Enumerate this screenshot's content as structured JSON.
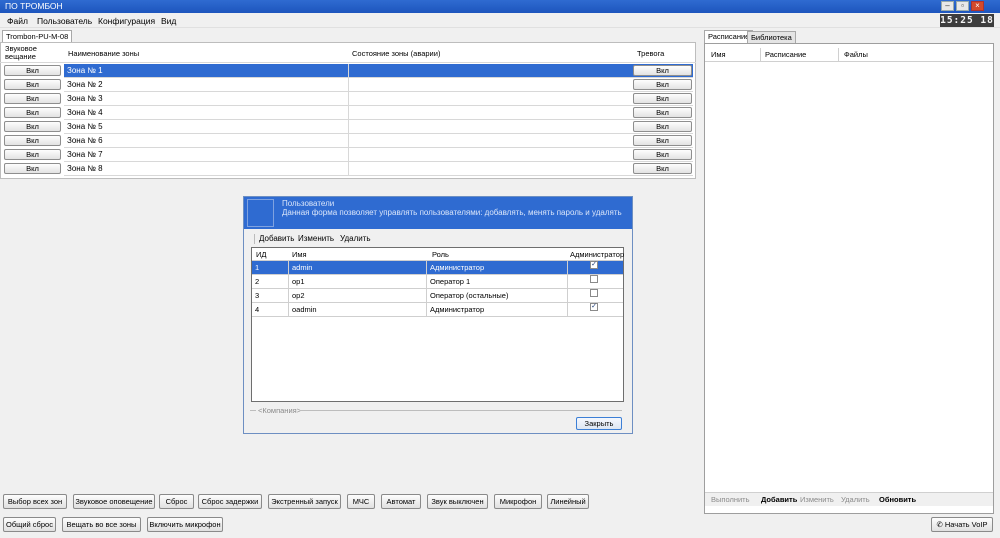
{
  "window": {
    "title": "ПО ТРОМБОН",
    "minimize": "–",
    "maximize": "▫",
    "close": "×"
  },
  "menu": [
    "Файл",
    "Пользователь",
    "Конфигурация",
    "Вид"
  ],
  "clock": "15:25 18",
  "device_tab": "Trombon-PU-M-08",
  "zones": {
    "headers": {
      "broadcast": "Звуковое вещание",
      "name": "Наименование зоны",
      "state": "Состояние зоны (аварии)",
      "alarm": "Тревога"
    },
    "button_label": "Вкл",
    "rows": [
      {
        "name": "Зона № 1"
      },
      {
        "name": "Зона № 2"
      },
      {
        "name": "Зона № 3"
      },
      {
        "name": "Зона № 4"
      },
      {
        "name": "Зона № 5"
      },
      {
        "name": "Зона № 6"
      },
      {
        "name": "Зона № 7"
      },
      {
        "name": "Зона № 8"
      }
    ],
    "selected_index": 0
  },
  "right_panel": {
    "tabs": [
      "Расписание",
      "Библиотека"
    ],
    "columns": [
      "Имя",
      "Расписание",
      "Файлы"
    ],
    "toolbar": {
      "run": "Выполнить",
      "add": "Добавить",
      "edit": "Изменить",
      "delete": "Удалить",
      "refresh": "Обновить"
    }
  },
  "bottom": {
    "row1": [
      "Выбор всех зон",
      "Звуковое оповещение",
      "Сброс",
      "Сброс задержки",
      "Экстренный запуск",
      "МЧС",
      "Автомат",
      "Звук выключен",
      "Микрофон",
      "Линейный"
    ],
    "row2": [
      "Общий сброс",
      "Вещать во все зоны",
      "Включить микрофон"
    ],
    "voip": "Начать VoIP"
  },
  "dialog": {
    "title": "Пользователи",
    "description": "Данная форма позволяет управлять пользователями: добавлять, менять  пароль и удалять",
    "toolbar": {
      "add": "Добавить",
      "edit": "Изменить",
      "delete": "Удалить"
    },
    "columns": {
      "id": "ИД",
      "name": "Имя",
      "role": "Роль",
      "admin": "Администратор"
    },
    "users": [
      {
        "id": "1",
        "name": "admin",
        "role": "Администратор",
        "admin": true
      },
      {
        "id": "2",
        "name": "op1",
        "role": "Оператор 1",
        "admin": false
      },
      {
        "id": "3",
        "name": "op2",
        "role": "Оператор (остальные)",
        "admin": false
      },
      {
        "id": "4",
        "name": "oadmin",
        "role": "Администратор",
        "admin": true
      }
    ],
    "selected_index": 0,
    "company": "<Компания>",
    "close": "Закрыть"
  }
}
